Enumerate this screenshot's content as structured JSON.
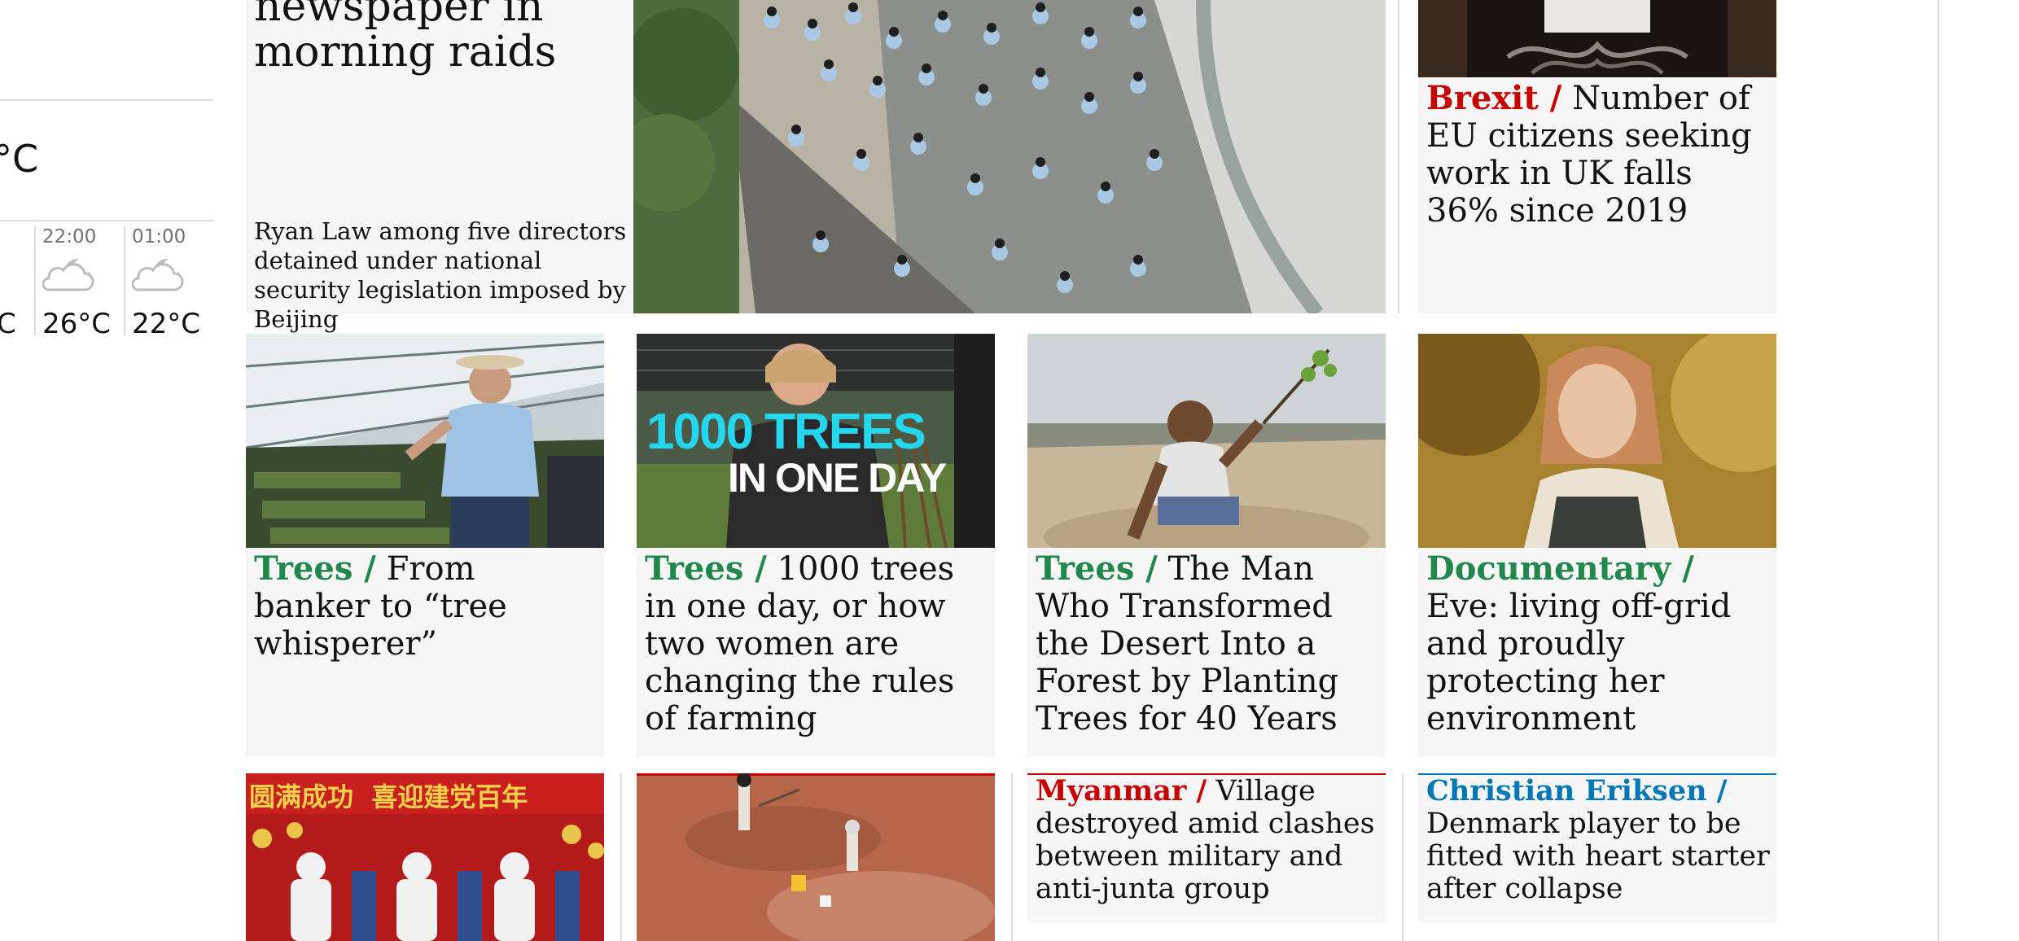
{
  "colors": {
    "news_red": "#c70000",
    "trees_green": "#22874d",
    "sport_blue": "#0077b6",
    "card_bg": "#f6f6f6",
    "rule": "#dcdcdc"
  },
  "weather": {
    "current_temp": "°C",
    "forecast": [
      {
        "time": "",
        "icon": "partly-sunny-icon",
        "temp": "C"
      },
      {
        "time": "22:00",
        "icon": "cloudy-night-icon",
        "temp": "26°C"
      },
      {
        "time": "01:00",
        "icon": "cloudy-night-icon",
        "temp": "22°C"
      }
    ]
  },
  "lead_story": {
    "headline": "newspaper in morning raids",
    "standfirst": "Ryan Law among five directors detained under national security legislation imposed by Beijing",
    "image": "police-officers-crowd-photo"
  },
  "brexit_card": {
    "kicker": "Brexit /",
    "headline": "Number of EU citizens seeking work in UK falls 36% since 2019",
    "image": "ornate-sign-photo"
  },
  "row2": [
    {
      "kicker": "Trees /",
      "headline": "From banker to “tree whisperer”",
      "image": "man-in-greenhouse-photo"
    },
    {
      "kicker": "Trees /",
      "headline": "1000 trees in one day, or how two women are changing the rules of farming",
      "image": "woman-with-saplings-photo",
      "overlay_line1": "1000 TREES",
      "overlay_line2": "IN ONE DAY"
    },
    {
      "kicker": "Trees /",
      "headline": "The Man Who Transformed the Desert Into a Forest by Planting Trees for 40 Years",
      "image": "man-planting-sapling-photo"
    },
    {
      "kicker": "Documentary /",
      "headline": "Eve: living off-grid and proudly protecting her environment",
      "image": "girl-in-overalls-photo"
    }
  ],
  "row3": [
    {
      "image": "astronauts-waving-photo",
      "banner_text": "圆满成功  喜迎建党百年"
    },
    {
      "image": "desert-excavation-photo"
    },
    {
      "kicker": "Myanmar /",
      "headline": "Village destroyed amid clashes between military and anti-junta group"
    },
    {
      "kicker": "Christian Eriksen /",
      "headline": "Denmark player to be fitted with heart starter after collapse"
    }
  ]
}
